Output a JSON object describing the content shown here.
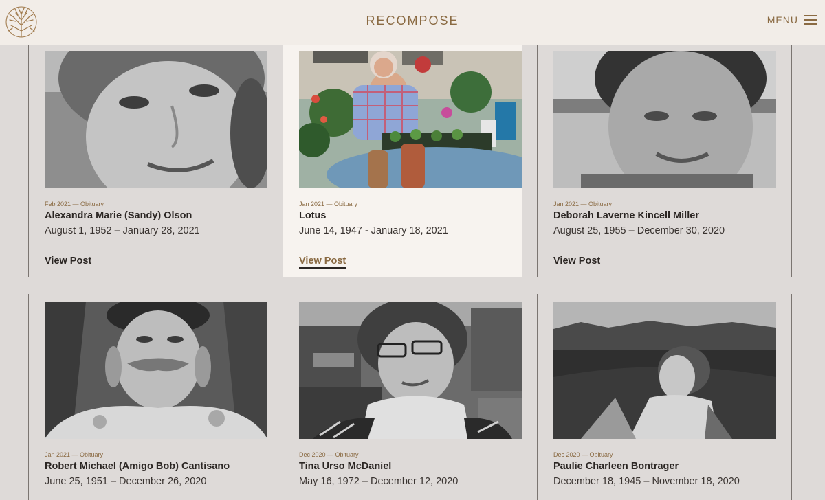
{
  "header": {
    "brand": "RECOMPOSE",
    "menu_label": "MENU"
  },
  "posts": [
    {
      "meta": "Feb 2021 — Obituary",
      "name": "Alexandra Marie (Sandy) Olson",
      "dates": "August 1, 1952 – January 28, 2021",
      "view": "View Post"
    },
    {
      "meta": "Jan 2021 — Obituary",
      "name": "Lotus",
      "dates": "June 14, 1947 - January 18, 2021",
      "view": "View Post"
    },
    {
      "meta": "Jan 2021 — Obituary",
      "name": "Deborah Laverne Kincell Miller",
      "dates": "August 25, 1955 – December 30, 2020",
      "view": "View Post"
    },
    {
      "meta": "Jan 2021 — Obituary",
      "name": "Robert Michael (Amigo Bob) Cantisano",
      "dates": "June 25, 1951 – December 26, 2020"
    },
    {
      "meta": "Dec 2020 — Obituary",
      "name": "Tina Urso McDaniel",
      "dates": "May 16, 1972 – December 12, 2020"
    },
    {
      "meta": "Dec 2020 — Obituary",
      "name": "Paulie Charleen Bontrager",
      "dates": "December 18, 1945 – November 18, 2020"
    }
  ]
}
